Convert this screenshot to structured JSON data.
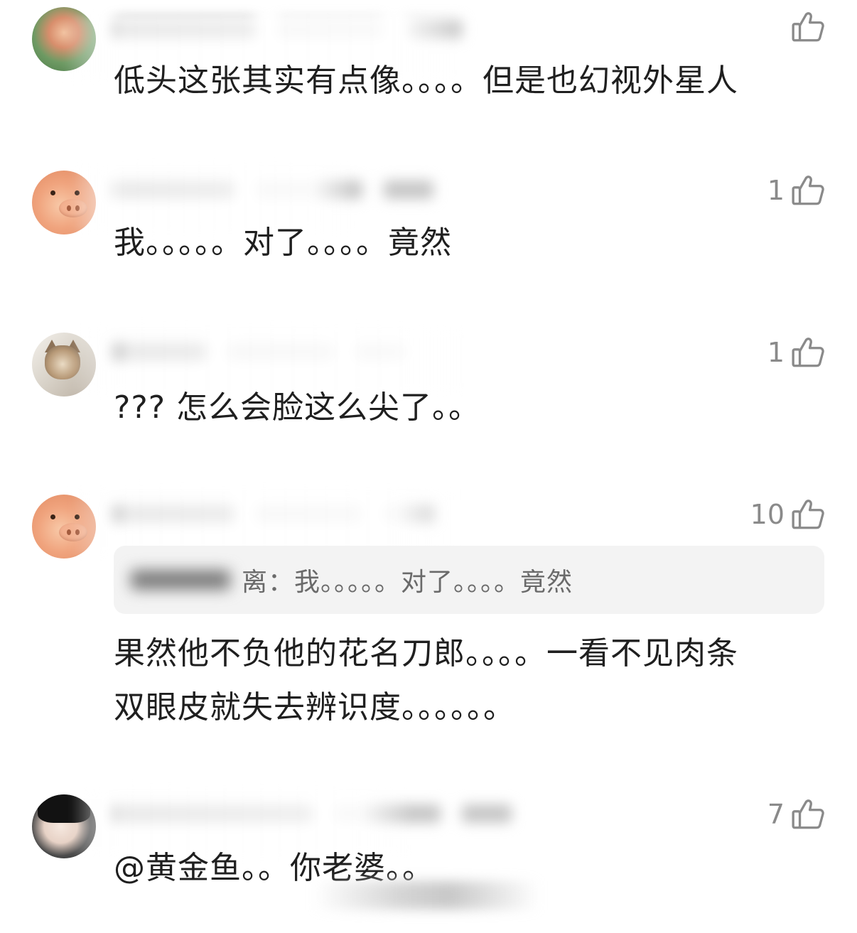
{
  "icons": {
    "like": "thumbs-up-icon"
  },
  "colors": {
    "text": "#1f1f1f",
    "like": "#8a8a8a",
    "quote_bg": "#f3f3f3"
  },
  "comments": [
    {
      "like_count": "",
      "text": "低头这张其实有点像。。。。但是也幻视外星人"
    },
    {
      "like_count": "1",
      "text": "我。。。。。对了。。。。竟然"
    },
    {
      "like_count": "1",
      "text": "??? 怎么会脸这么尖了。。"
    },
    {
      "like_count": "10",
      "quote": {
        "name_suffix": "离：",
        "text": "我。。。。。对了。。。。竟然"
      },
      "text": "果然他不负他的花名刀郎。。。。一看不见肉条\n双眼皮就失去辨识度。。。。。。"
    },
    {
      "like_count": "7",
      "text": "@黄金鱼。。你老婆。。"
    }
  ]
}
